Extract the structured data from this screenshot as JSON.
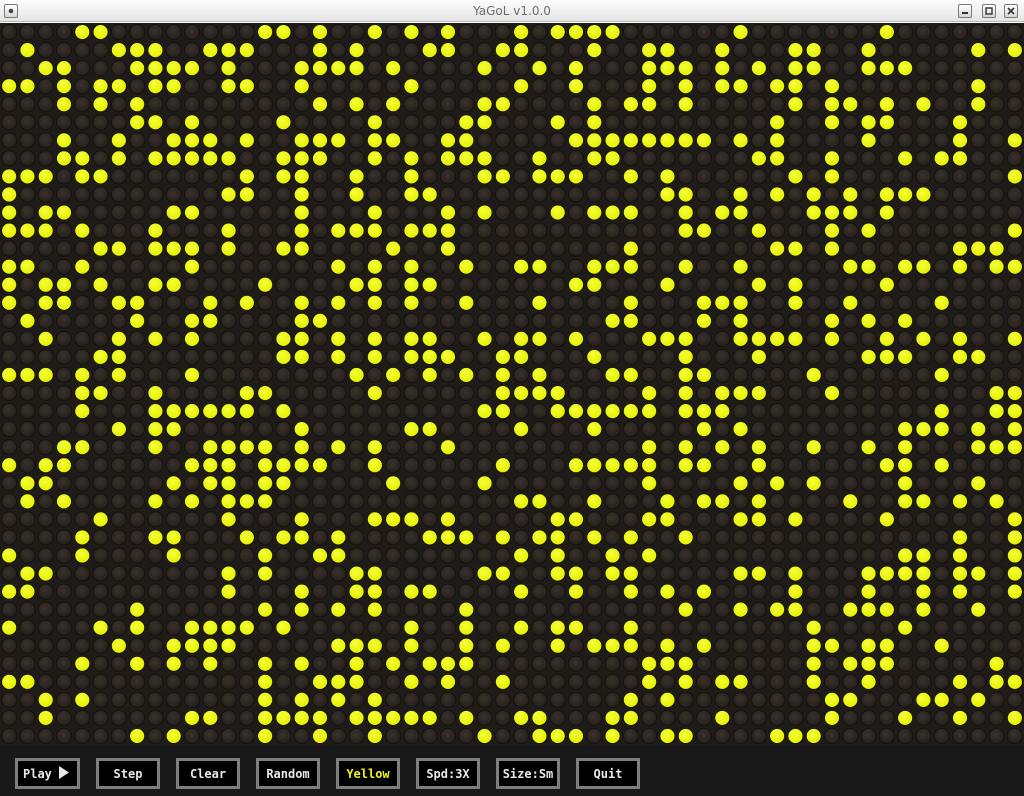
{
  "window": {
    "title": "YaGoL v1.0.0"
  },
  "grid": {
    "columns": 56,
    "rows": 40,
    "live_color": "#e6f000",
    "dead_color": "#2b2521",
    "background": "#1e1b18",
    "cells": [
      "....................................................",
      "",
      "",
      ""
    ]
  },
  "controls": {
    "play_label": "Play",
    "play_icon": "play-triangle-icon",
    "step_label": "Step",
    "clear_label": "Clear",
    "random_label": "Random",
    "color_label": "Yellow",
    "speed_label": "Spd:3X",
    "size_label": "Size:Sm",
    "quit_label": "Quit"
  }
}
